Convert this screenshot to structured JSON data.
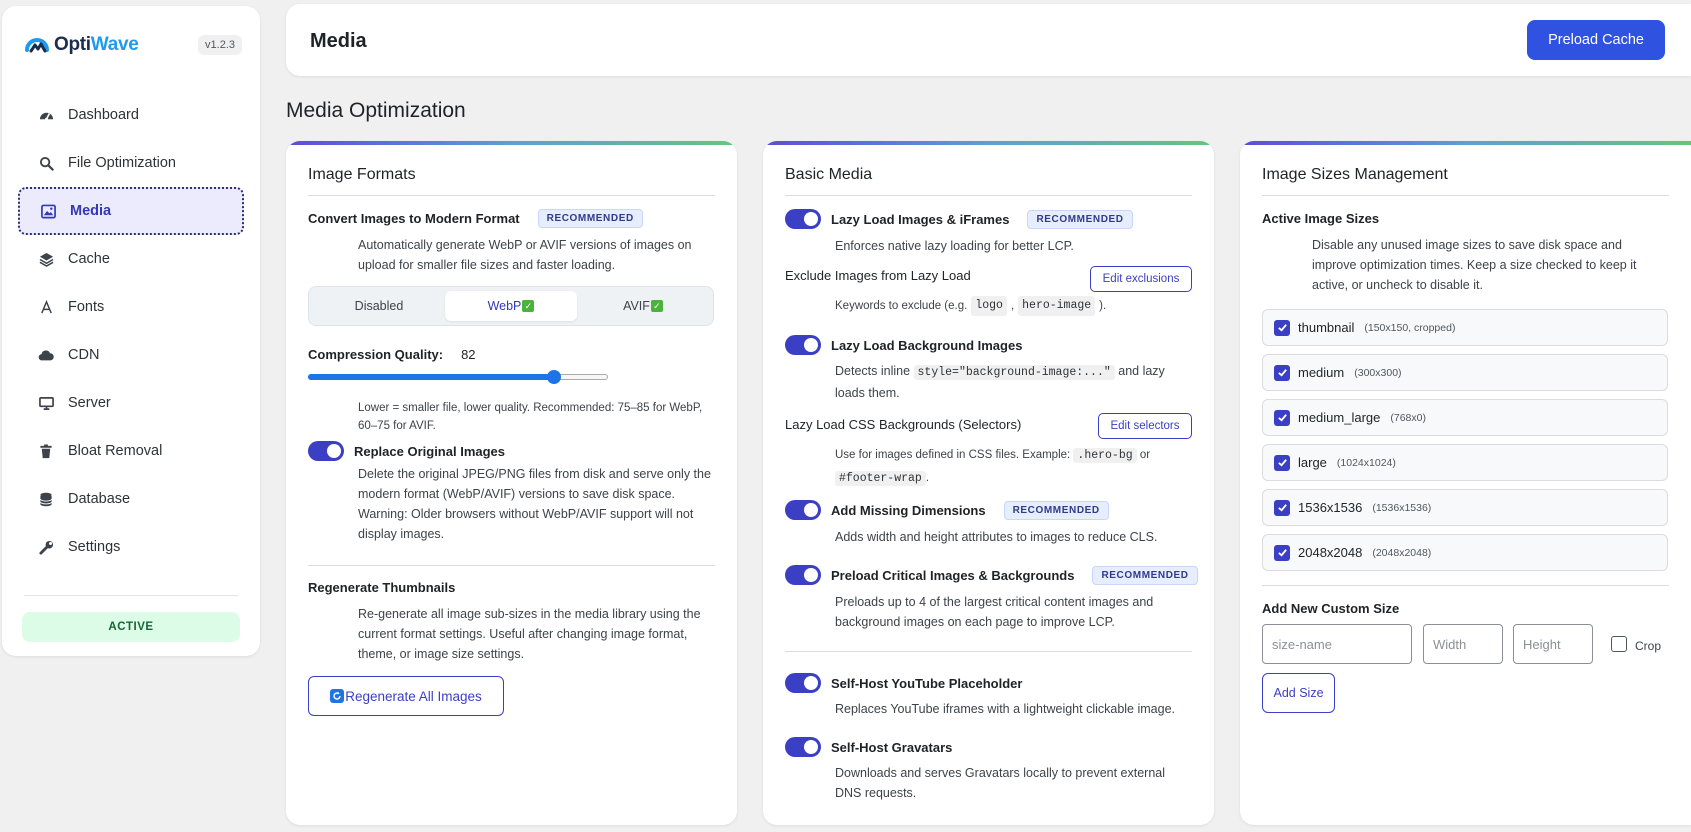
{
  "app": {
    "name_a": "Opti",
    "name_b": "Wave",
    "version": "v1.2.3",
    "status": "ACTIVE"
  },
  "sidebar": {
    "items": [
      {
        "label": "Dashboard",
        "icon": "gauge-icon"
      },
      {
        "label": "File Optimization",
        "icon": "search-icon"
      },
      {
        "label": "Media",
        "icon": "image-icon",
        "active": true
      },
      {
        "label": "Cache",
        "icon": "layers-icon"
      },
      {
        "label": "Fonts",
        "icon": "font-icon"
      },
      {
        "label": "CDN",
        "icon": "cloud-icon"
      },
      {
        "label": "Server",
        "icon": "monitor-icon"
      },
      {
        "label": "Bloat Removal",
        "icon": "trash-icon"
      },
      {
        "label": "Database",
        "icon": "database-icon"
      },
      {
        "label": "Settings",
        "icon": "wrench-icon"
      }
    ]
  },
  "header": {
    "title": "Media",
    "preload_label": "Preload Cache"
  },
  "section_title": "Media Optimization",
  "formats": {
    "title": "Image Formats",
    "convert_label": "Convert Images to Modern Format",
    "recommended": "RECOMMENDED",
    "convert_desc": "Automatically generate WebP or AVIF versions of images on upload for smaller file sizes and faster loading.",
    "options": [
      "Disabled",
      "WebP",
      "AVIF"
    ],
    "selected": "WebP",
    "quality_label": "Compression Quality:",
    "quality_value": "82",
    "quality_fraction": 0.82,
    "quality_help": "Lower = smaller file, lower quality. Recommended: 75–85 for WebP, 60–75 for AVIF.",
    "replace_label": "Replace Original Images",
    "replace_enabled": true,
    "replace_desc": "Delete the original JPEG/PNG files from disk and serve only the modern format (WebP/AVIF) versions to save disk space. Warning: Older browsers without WebP/AVIF support will not display images.",
    "regen_label": "Regenerate Thumbnails",
    "regen_desc": "Re-generate all image sub-sizes in the media library using the current format settings. Useful after changing image format, theme, or image size settings.",
    "regen_button": "Regenerate All Images"
  },
  "basic": {
    "title": "Basic Media",
    "recommended": "RECOMMENDED",
    "lazy_label": "Lazy Load Images & iFrames",
    "lazy_desc": "Enforces native lazy loading for better LCP.",
    "exclude_label": "Exclude Images from Lazy Load",
    "exclude_button": "Edit exclusions",
    "exclude_desc_a": "Keywords to exclude (e.g.",
    "exclude_code_1": "logo",
    "exclude_sep": ",",
    "exclude_code_2": "hero-image",
    "exclude_desc_b": ").",
    "bg_label": "Lazy Load Background Images",
    "bg_desc_a": "Detects inline",
    "bg_code": "style=\"background-image:...\"",
    "bg_desc_b": "and lazy loads them.",
    "css_label": "Lazy Load CSS Backgrounds (Selectors)",
    "css_button": "Edit selectors",
    "css_desc_a": "Use for images defined in CSS files. Example:",
    "css_code_1": ".hero-bg",
    "css_or": "or",
    "css_code_2": "#footer-wrap",
    "css_desc_b": ".",
    "dims_label": "Add Missing Dimensions",
    "dims_desc": "Adds width and height attributes to images to reduce CLS.",
    "preload_label": "Preload Critical Images & Backgrounds",
    "preload_desc": "Preloads up to 4 of the largest critical content images and background images on each page to improve LCP.",
    "yt_label": "Self-Host YouTube Placeholder",
    "yt_desc": "Replaces YouTube iframes with a lightweight clickable image.",
    "grav_label": "Self-Host Gravatars",
    "grav_desc": "Downloads and serves Gravatars locally to prevent external DNS requests."
  },
  "sizes": {
    "title": "Image Sizes Management",
    "active_label": "Active Image Sizes",
    "active_desc": "Disable any unused image sizes to save disk space and improve optimization times. Keep a size checked to keep it active, or uncheck to disable it.",
    "rows": [
      {
        "name": "thumbnail",
        "dim": "(150x150, cropped)"
      },
      {
        "name": "medium",
        "dim": "(300x300)"
      },
      {
        "name": "medium_large",
        "dim": "(768x0)"
      },
      {
        "name": "large",
        "dim": "(1024x1024)"
      },
      {
        "name": "1536x1536",
        "dim": "(1536x1536)"
      },
      {
        "name": "2048x2048",
        "dim": "(2048x2048)"
      }
    ],
    "add_label": "Add New Custom Size",
    "name_placeholder": "size-name",
    "width_placeholder": "Width",
    "height_placeholder": "Height",
    "crop_label": "Crop",
    "add_button": "Add Size"
  },
  "colors": {
    "accent": "#3b3fc4",
    "primary_button": "#2f52e0",
    "active_green": "#dcfce7"
  }
}
